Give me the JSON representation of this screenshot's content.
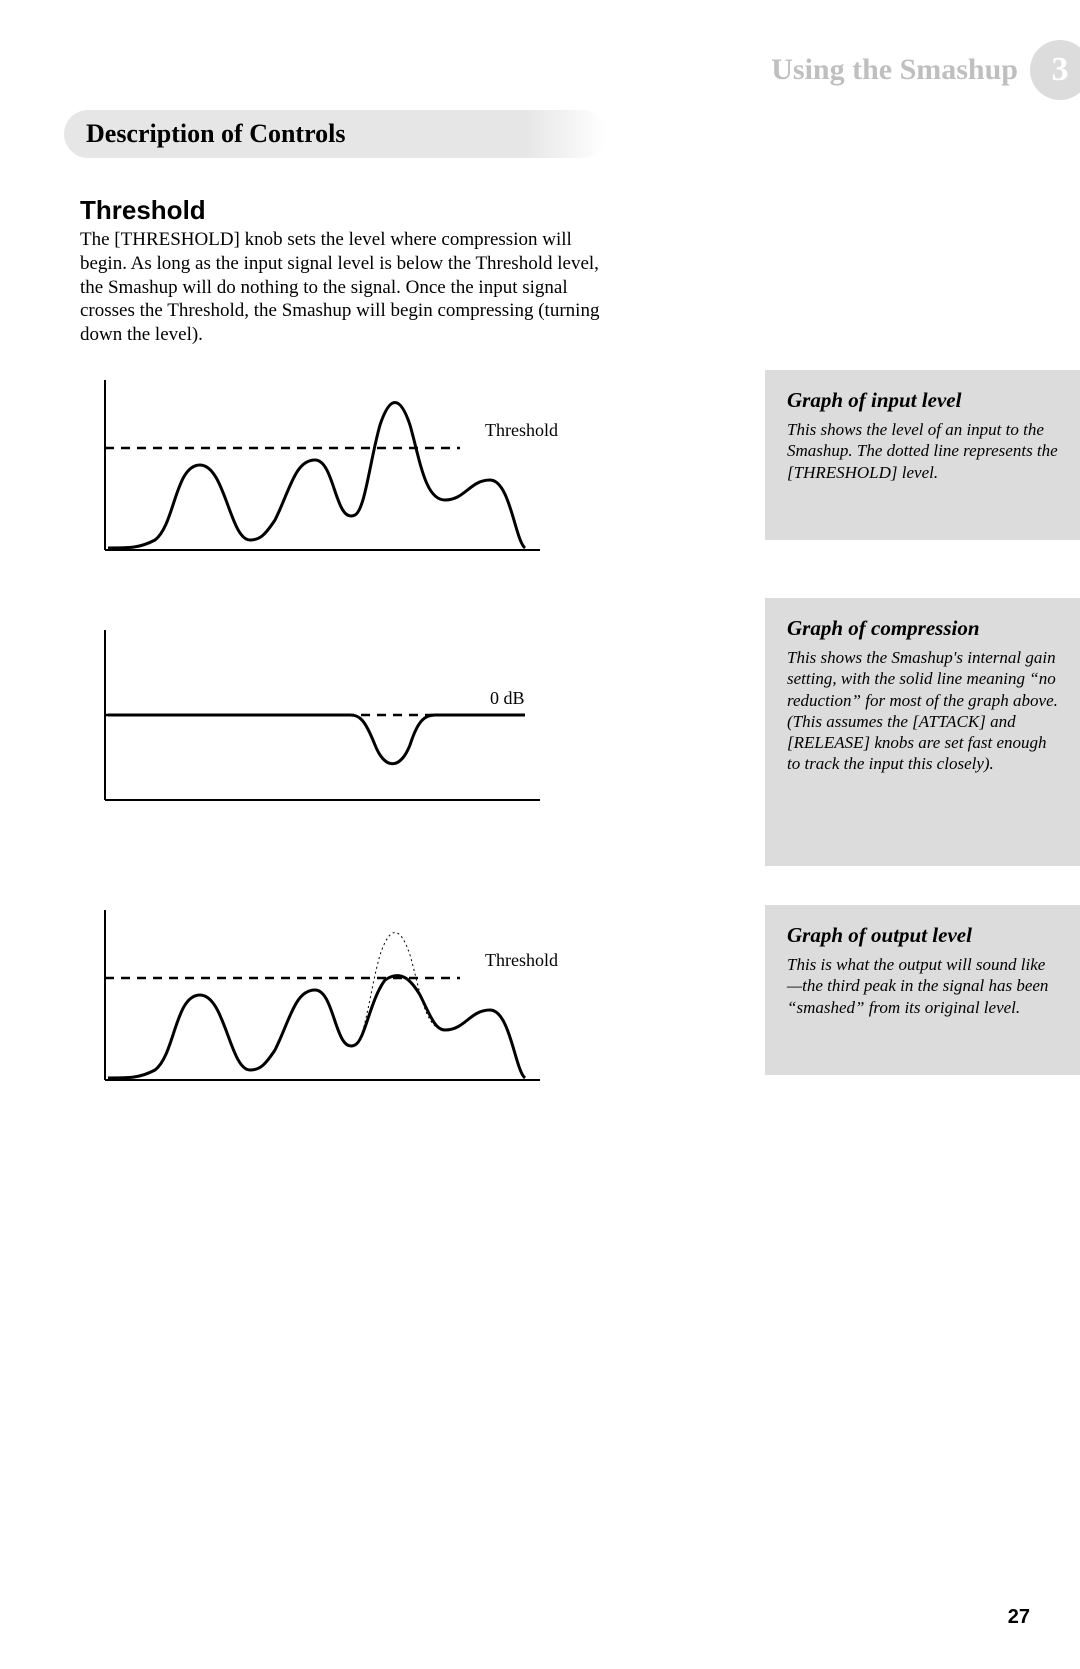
{
  "header": {
    "title": "Using the Smashup",
    "chapter": "3"
  },
  "section_title": "Description of Controls",
  "subsection_title": "Threshold",
  "body": "The [THRESHOLD] knob sets the level where compression will begin.  As long as the input signal level is below the Threshold level, the Smashup will do nothing to the signal.  Once the input signal crosses the Threshold, the Smashup will begin compressing (turning down the level).",
  "graphs": {
    "input": {
      "label": "Threshold"
    },
    "compression": {
      "label": "0 dB"
    },
    "output": {
      "label": "Threshold"
    }
  },
  "sidebars": {
    "input": {
      "title": "Graph of input level",
      "body": "This shows the level of an input to the Smashup. The dotted line represents the [THRESHOLD] level."
    },
    "compression": {
      "title": "Graph of compression",
      "body": "This shows the Smashup's internal gain setting, with the solid line meaning “no reduction” for most of the graph above.  (This assumes the [ATTACK] and [RELEASE] knobs are set fast enough to track the input this closely)."
    },
    "output": {
      "title": "Graph of output level",
      "body": "This is what the output will sound like—the third peak in the signal has been “smashed” from its original level."
    }
  },
  "page_number": "27"
}
